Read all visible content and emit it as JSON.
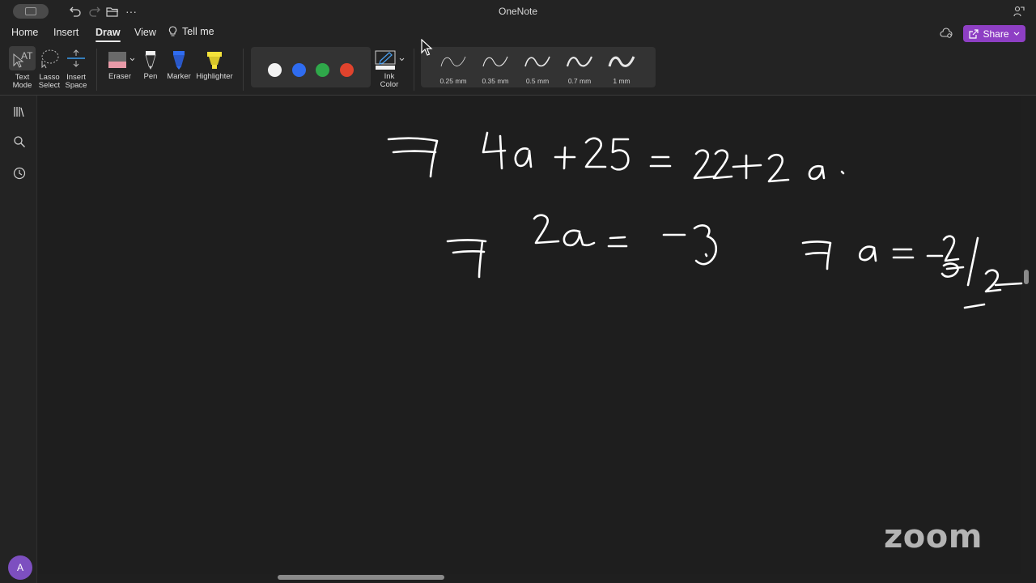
{
  "window": {
    "title": "OneNote"
  },
  "titlebar": {
    "icons": [
      "sidebar-toggle-icon",
      "undo-icon",
      "redo-icon",
      "open-folder-icon",
      "more-icon"
    ]
  },
  "tabs": [
    {
      "label": "Home"
    },
    {
      "label": "Insert"
    },
    {
      "label": "Draw"
    },
    {
      "label": "View"
    },
    {
      "label": "Tell me"
    }
  ],
  "active_tab": "Draw",
  "share": {
    "label": "Share"
  },
  "ribbon": {
    "text_mode": {
      "line1": "Text",
      "line2": "Mode"
    },
    "lasso_select": {
      "line1": "Lasso",
      "line2": "Select"
    },
    "insert_space": {
      "line1": "Insert",
      "line2": "Space"
    },
    "eraser": "Eraser",
    "pen": "Pen",
    "marker": "Marker",
    "highlighter": "Highlighter",
    "colors": [
      "#f2f2f2",
      "#2f6cf0",
      "#2fa84a",
      "#e0432d"
    ],
    "ink_color": {
      "line1": "Ink",
      "line2": "Color"
    },
    "thicknesses": [
      {
        "label": "0.25 mm"
      },
      {
        "label": "0.35 mm"
      },
      {
        "label": "0.5 mm"
      },
      {
        "label": "0.7 mm"
      },
      {
        "label": "1 mm"
      }
    ]
  },
  "leftnav": {
    "icons": [
      "notebooks-icon",
      "search-icon",
      "recent-icon"
    ],
    "avatar_initial": "A"
  },
  "overlay": {
    "zoom_logo": "zoom"
  },
  "colors": {
    "accent": "#8e3fc4",
    "canvas": "#1e1e1e",
    "ink": "#ffffff"
  }
}
